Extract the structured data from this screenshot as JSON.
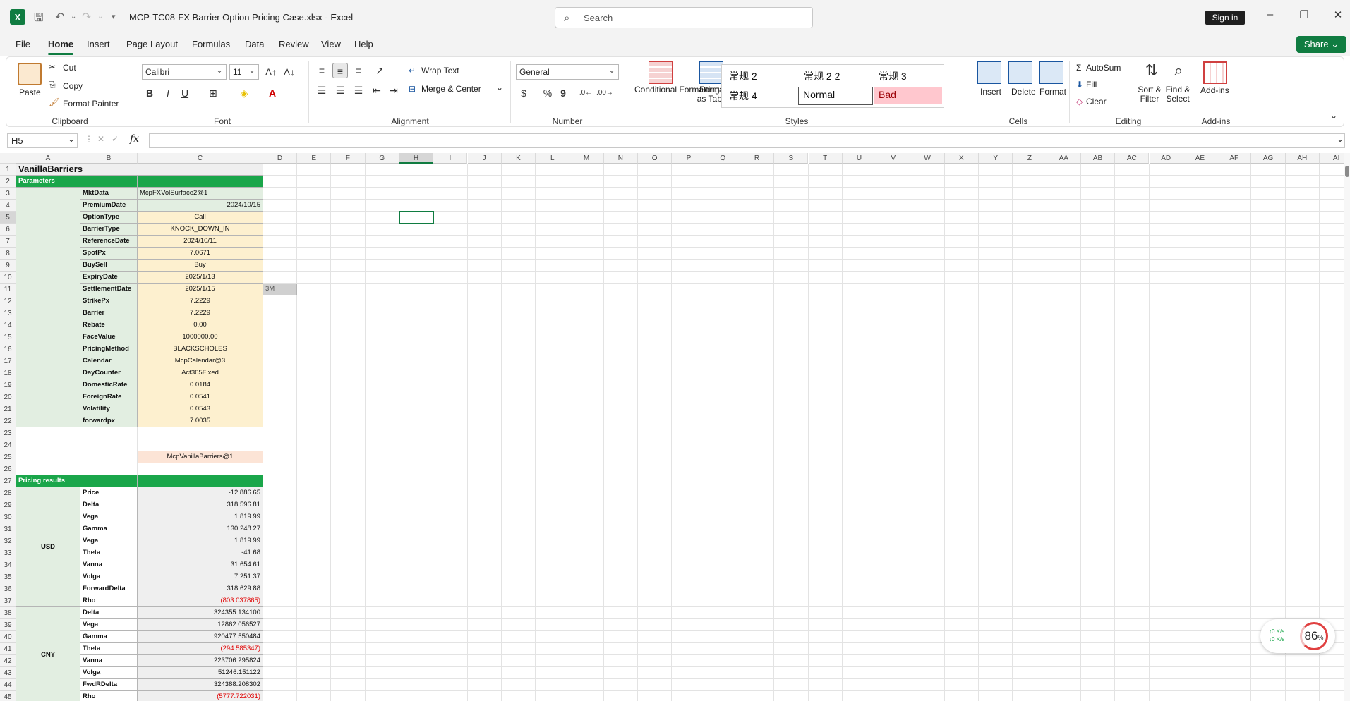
{
  "app": {
    "title": "MCP-TC08-FX Barrier Option Pricing Case.xlsx  -  Excel",
    "logo": "X",
    "search_placeholder": "Search",
    "signin": "Sign in",
    "share": "Share"
  },
  "menu": [
    "File",
    "Home",
    "Insert",
    "Page Layout",
    "Formulas",
    "Data",
    "Review",
    "View",
    "Help"
  ],
  "ribbon": {
    "clipboard": {
      "label": "Clipboard",
      "paste": "Paste",
      "cut": "Cut",
      "copy": "Copy",
      "format_painter": "Format Painter"
    },
    "font": {
      "label": "Font",
      "name": "Calibri",
      "size": "11",
      "bold": "B",
      "italic": "I",
      "underline": "U"
    },
    "alignment": {
      "label": "Alignment",
      "wrap": "Wrap Text",
      "merge": "Merge & Center"
    },
    "number": {
      "label": "Number",
      "format": "General",
      "percent": "%",
      "comma": "9"
    },
    "styles": {
      "label": "Styles",
      "conditional": "Conditional Formatting",
      "format_table": "Format as Table",
      "s1": "常规 2",
      "s2": "常规 2 2",
      "s3": "常规  3",
      "s4": "常规  4",
      "normal": "Normal",
      "bad": "Bad"
    },
    "cells": {
      "label": "Cells",
      "insert": "Insert",
      "delete": "Delete",
      "format": "Format"
    },
    "editing": {
      "label": "Editing",
      "autosum": "AutoSum",
      "fill": "Fill",
      "clear": "Clear",
      "sort": "Sort & Filter",
      "find": "Find & Select"
    },
    "addins": {
      "label": "Add-ins",
      "addins": "Add-ins"
    }
  },
  "formula_bar": {
    "name_box": "H5",
    "fx": "fx",
    "content": ""
  },
  "columns": [
    "A",
    "B",
    "C",
    "D",
    "E",
    "F",
    "G",
    "H",
    "I",
    "J",
    "K",
    "L",
    "M",
    "N",
    "O",
    "P",
    "Q",
    "R",
    "S",
    "T",
    "U",
    "V",
    "W",
    "X",
    "Y",
    "Z",
    "AA",
    "AB",
    "AC",
    "AD",
    "AE",
    "AF",
    "AG",
    "AH",
    "AI"
  ],
  "rows": [
    "1",
    "2",
    "3",
    "4",
    "5",
    "6",
    "7",
    "8",
    "9",
    "10",
    "11",
    "12",
    "13",
    "14",
    "15",
    "16",
    "17",
    "18",
    "19",
    "20",
    "21",
    "22",
    "23",
    "24",
    "25",
    "26",
    "27",
    "28",
    "29",
    "30",
    "31",
    "32",
    "33",
    "34",
    "35",
    "36",
    "37",
    "38",
    "39",
    "40",
    "41",
    "42",
    "43",
    "44",
    "45"
  ],
  "sheet": {
    "title": "VanillaBarriers",
    "parameters_header": "Parameters",
    "params": [
      {
        "k": "MktData",
        "v": "McpFXVolSurface2@1"
      },
      {
        "k": "PremiumDate",
        "v": "2024/10/15"
      },
      {
        "k": "OptionType",
        "v": "Call"
      },
      {
        "k": "BarrierType",
        "v": "KNOCK_DOWN_IN"
      },
      {
        "k": "ReferenceDate",
        "v": "2024/10/11"
      },
      {
        "k": "SpotPx",
        "v": "7.0671"
      },
      {
        "k": "BuySell",
        "v": "Buy"
      },
      {
        "k": "ExpiryDate",
        "v": "2025/1/13"
      },
      {
        "k": "SettlementDate",
        "v": "2025/1/15"
      },
      {
        "k": "StrikePx",
        "v": "7.2229"
      },
      {
        "k": "Barrier",
        "v": "7.2229"
      },
      {
        "k": "Rebate",
        "v": "0.00"
      },
      {
        "k": "FaceValue",
        "v": "1000000.00"
      },
      {
        "k": "PricingMethod",
        "v": "BLACKSCHOLES"
      },
      {
        "k": "Calendar",
        "v": "McpCalendar@3"
      },
      {
        "k": "DayCounter",
        "v": "Act365Fixed"
      },
      {
        "k": "DomesticRate",
        "v": "0.0184"
      },
      {
        "k": "ForeignRate",
        "v": "0.0541"
      },
      {
        "k": "Volatility",
        "v": "0.0543"
      },
      {
        "k": "forwardpx",
        "v": "7.0035"
      }
    ],
    "d11": "3M",
    "object_name": "McpVanillaBarriers@1",
    "results_header": "Pricing results",
    "usd_label": "USD",
    "cny_label": "CNY",
    "usd": [
      {
        "k": "Price",
        "v": "-12,886.65"
      },
      {
        "k": "Delta",
        "v": "318,596.81"
      },
      {
        "k": "Vega",
        "v": "1,819.99"
      },
      {
        "k": "Gamma",
        "v": "130,248.27"
      },
      {
        "k": "Vega",
        "v": "1,819.99"
      },
      {
        "k": "Theta",
        "v": "-41.68"
      },
      {
        "k": "Vanna",
        "v": "31,654.61"
      },
      {
        "k": "Volga",
        "v": "7,251.37"
      },
      {
        "k": "ForwardDelta",
        "v": "318,629.88"
      },
      {
        "k": "Rho",
        "v": "(803.037865)"
      }
    ],
    "cny": [
      {
        "k": "Delta",
        "v": "324355.134100"
      },
      {
        "k": "Vega",
        "v": "12862.056527"
      },
      {
        "k": "Gamma",
        "v": "920477.550484"
      },
      {
        "k": "Theta",
        "v": "(294.585347)"
      },
      {
        "k": "Vanna",
        "v": "223706.295824"
      },
      {
        "k": "Volga",
        "v": "51246.151122"
      },
      {
        "k": "FwdRDelta",
        "v": "324388.208302"
      },
      {
        "k": "Rho",
        "v": "(5777.722031)"
      }
    ]
  },
  "network": {
    "up": "↑0  K/s",
    "down": "↓0  K/s",
    "pct": "86"
  },
  "colors": {
    "accent": "#107c41",
    "param_green": "#1aa64a",
    "input_yellow": "#fdf0cf",
    "label_green": "#e2eee1",
    "negative": "#e00000"
  }
}
